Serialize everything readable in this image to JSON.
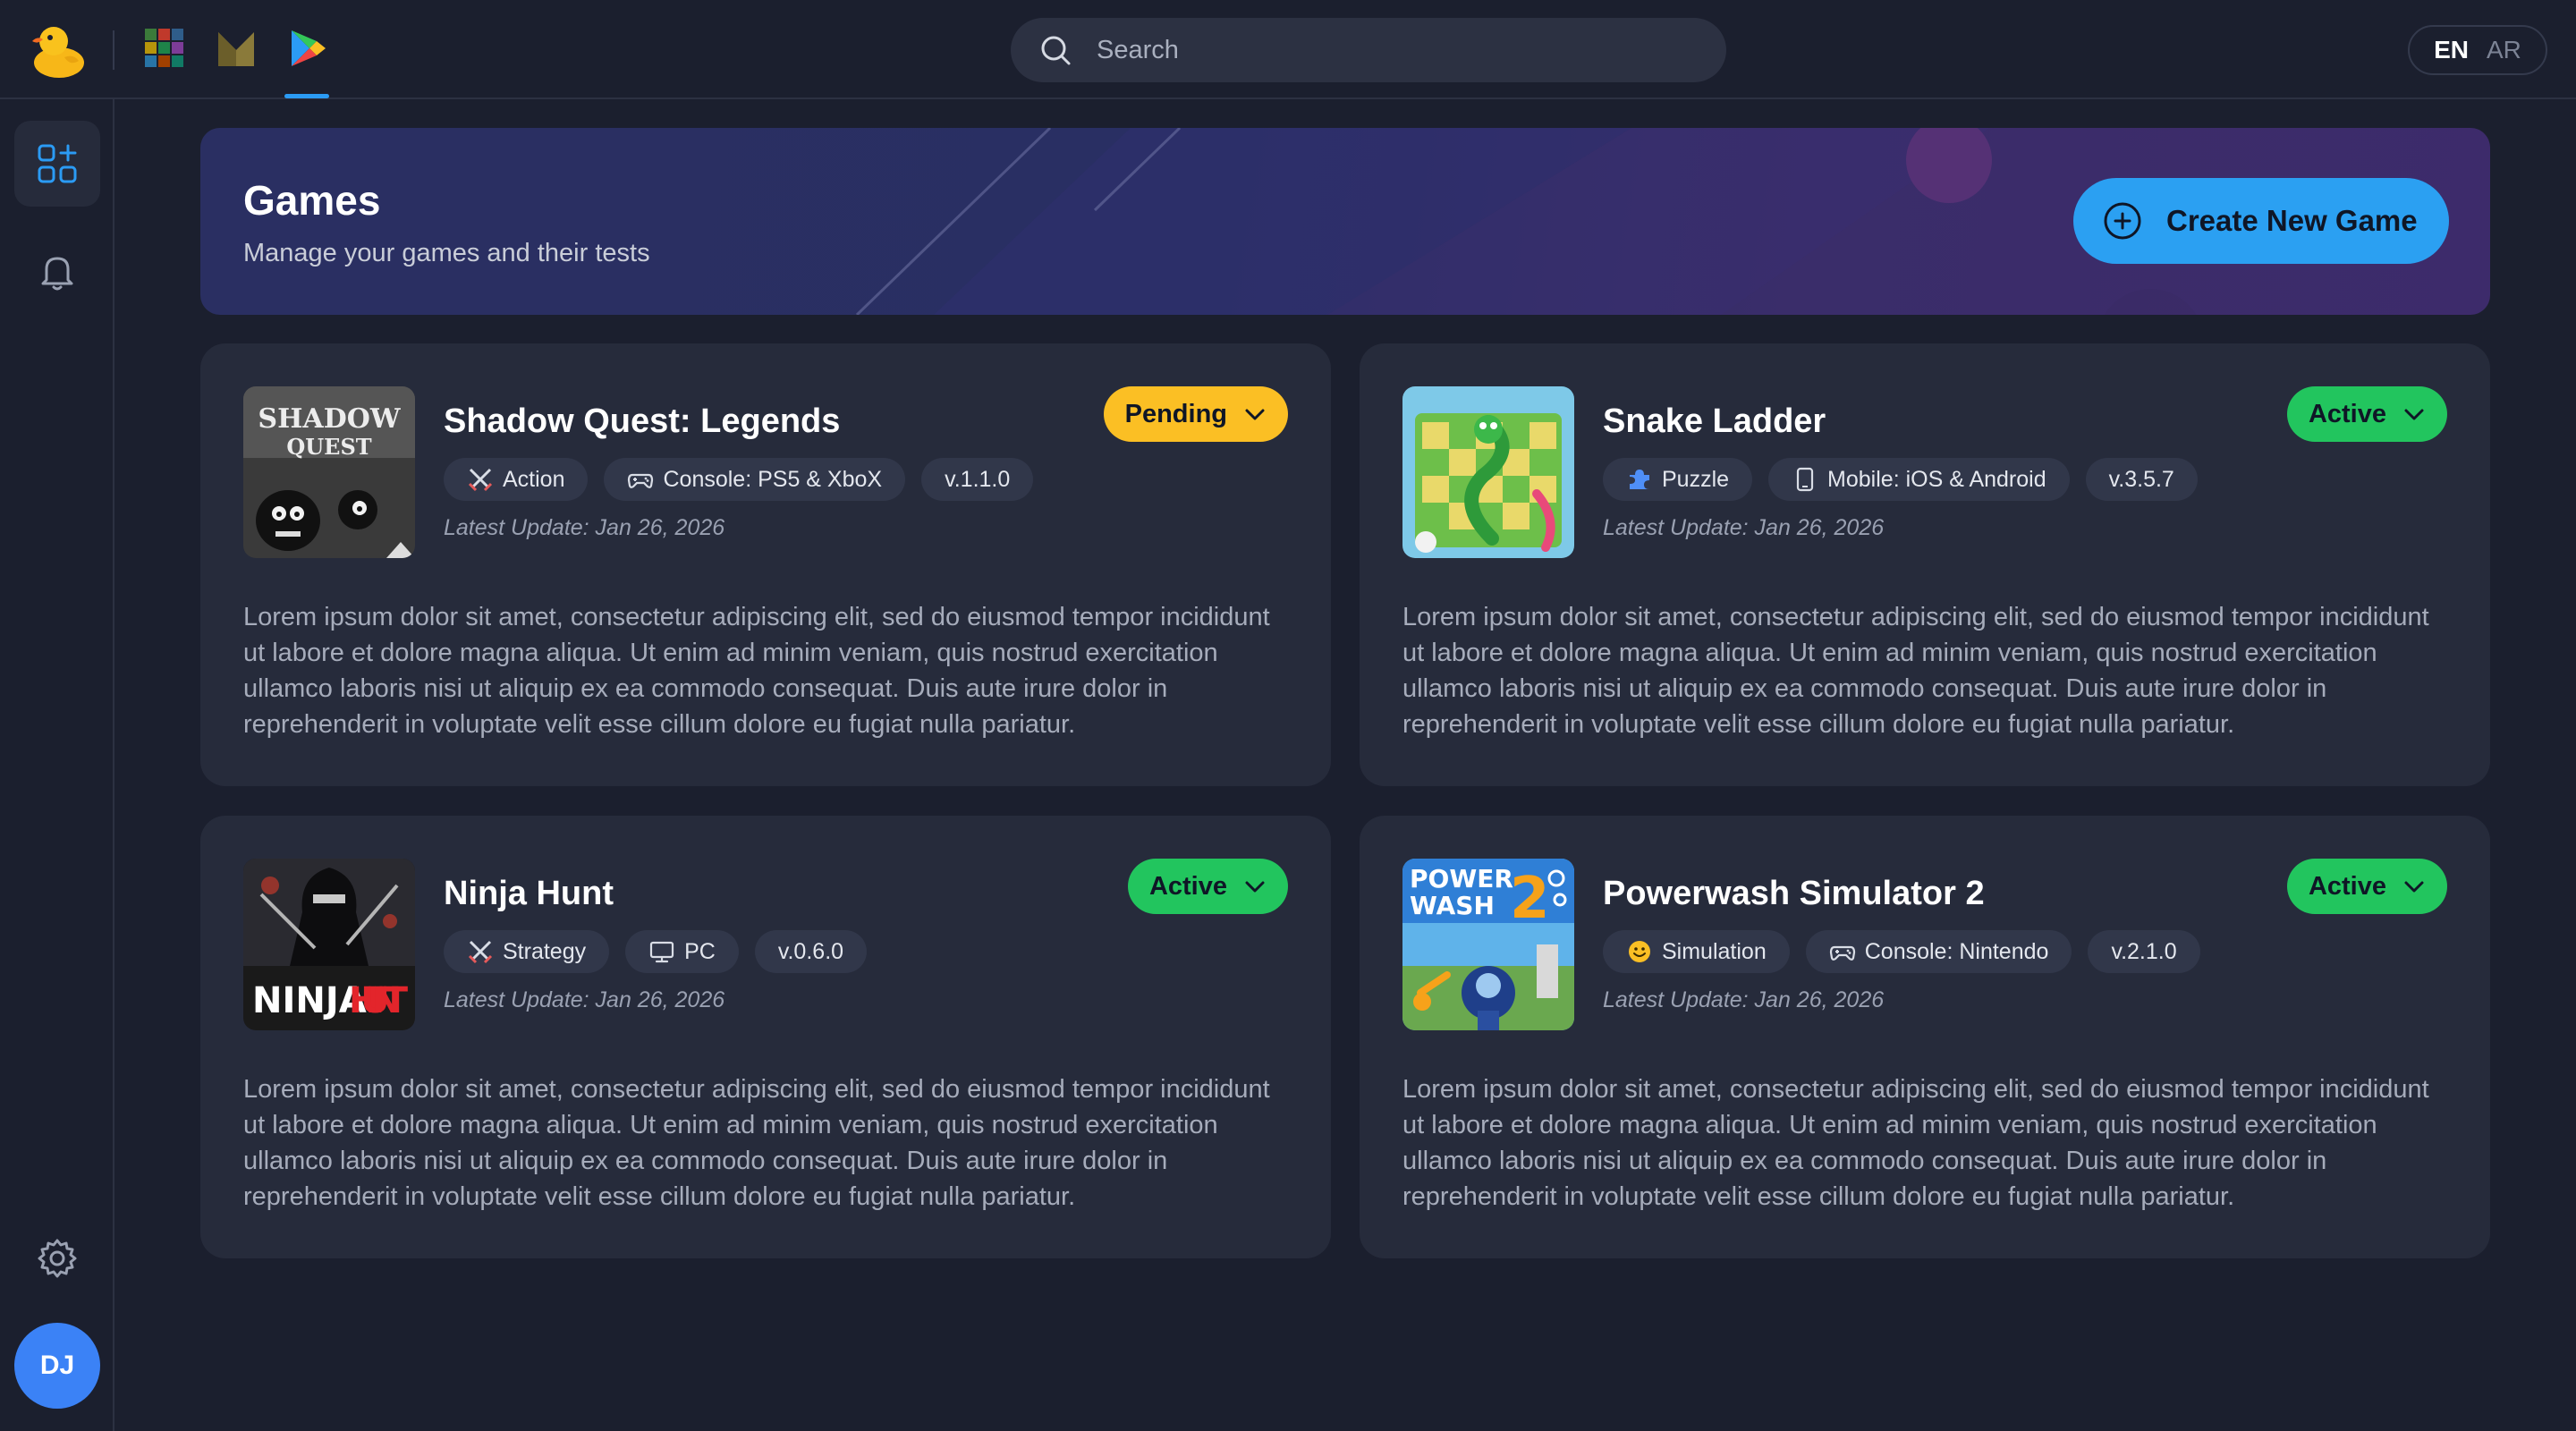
{
  "header": {
    "search_placeholder": "Search",
    "lang_en": "EN",
    "lang_ar": "AR"
  },
  "sidebar": {
    "avatar_initials": "DJ"
  },
  "banner": {
    "title": "Games",
    "subtitle": "Manage your games and their tests",
    "create_label": "Create New Game"
  },
  "colors": {
    "accent": "#2ba0f2",
    "pending": "#fbbf24",
    "active": "#22c55e"
  },
  "games": [
    {
      "title": "Shadow Quest: Legends",
      "status": "Pending",
      "genre": "Action",
      "platform": "Console: PS5 & XboX",
      "version": "v.1.1.0",
      "updated": "Latest Update: Jan 26, 2026",
      "description": "Lorem ipsum dolor sit amet, consectetur adipiscing elit, sed do eiusmod tempor incididunt ut labore et dolore magna aliqua. Ut enim ad minim veniam, quis nostrud exercitation ullamco laboris nisi ut aliquip ex ea commodo consequat. Duis aute irure dolor in reprehenderit in voluptate velit esse cillum dolore eu fugiat nulla pariatur."
    },
    {
      "title": "Snake Ladder",
      "status": "Active",
      "genre": "Puzzle",
      "platform": "Mobile: iOS & Android",
      "version": "v.3.5.7",
      "updated": "Latest Update: Jan 26, 2026",
      "description": "Lorem ipsum dolor sit amet, consectetur adipiscing elit, sed do eiusmod tempor incididunt ut labore et dolore magna aliqua. Ut enim ad minim veniam, quis nostrud exercitation ullamco laboris nisi ut aliquip ex ea commodo consequat. Duis aute irure dolor in reprehenderit in voluptate velit esse cillum dolore eu fugiat nulla pariatur."
    },
    {
      "title": "Ninja Hunt",
      "status": "Active",
      "genre": "Strategy",
      "platform": "PC",
      "version": "v.0.6.0",
      "updated": "Latest Update: Jan 26, 2026",
      "description": "Lorem ipsum dolor sit amet, consectetur adipiscing elit, sed do eiusmod tempor incididunt ut labore et dolore magna aliqua. Ut enim ad minim veniam, quis nostrud exercitation ullamco laboris nisi ut aliquip ex ea commodo consequat. Duis aute irure dolor in reprehenderit in voluptate velit esse cillum dolore eu fugiat nulla pariatur."
    },
    {
      "title": "Powerwash Simulator 2",
      "status": "Active",
      "genre": "Simulation",
      "platform": "Console: Nintendo",
      "version": "v.2.1.0",
      "updated": "Latest Update: Jan 26, 2026",
      "description": "Lorem ipsum dolor sit amet, consectetur adipiscing elit, sed do eiusmod tempor incididunt ut labore et dolore magna aliqua. Ut enim ad minim veniam, quis nostrud exercitation ullamco laboris nisi ut aliquip ex ea commodo consequat. Duis aute irure dolor in reprehenderit in voluptate velit esse cillum dolore eu fugiat nulla pariatur."
    }
  ]
}
